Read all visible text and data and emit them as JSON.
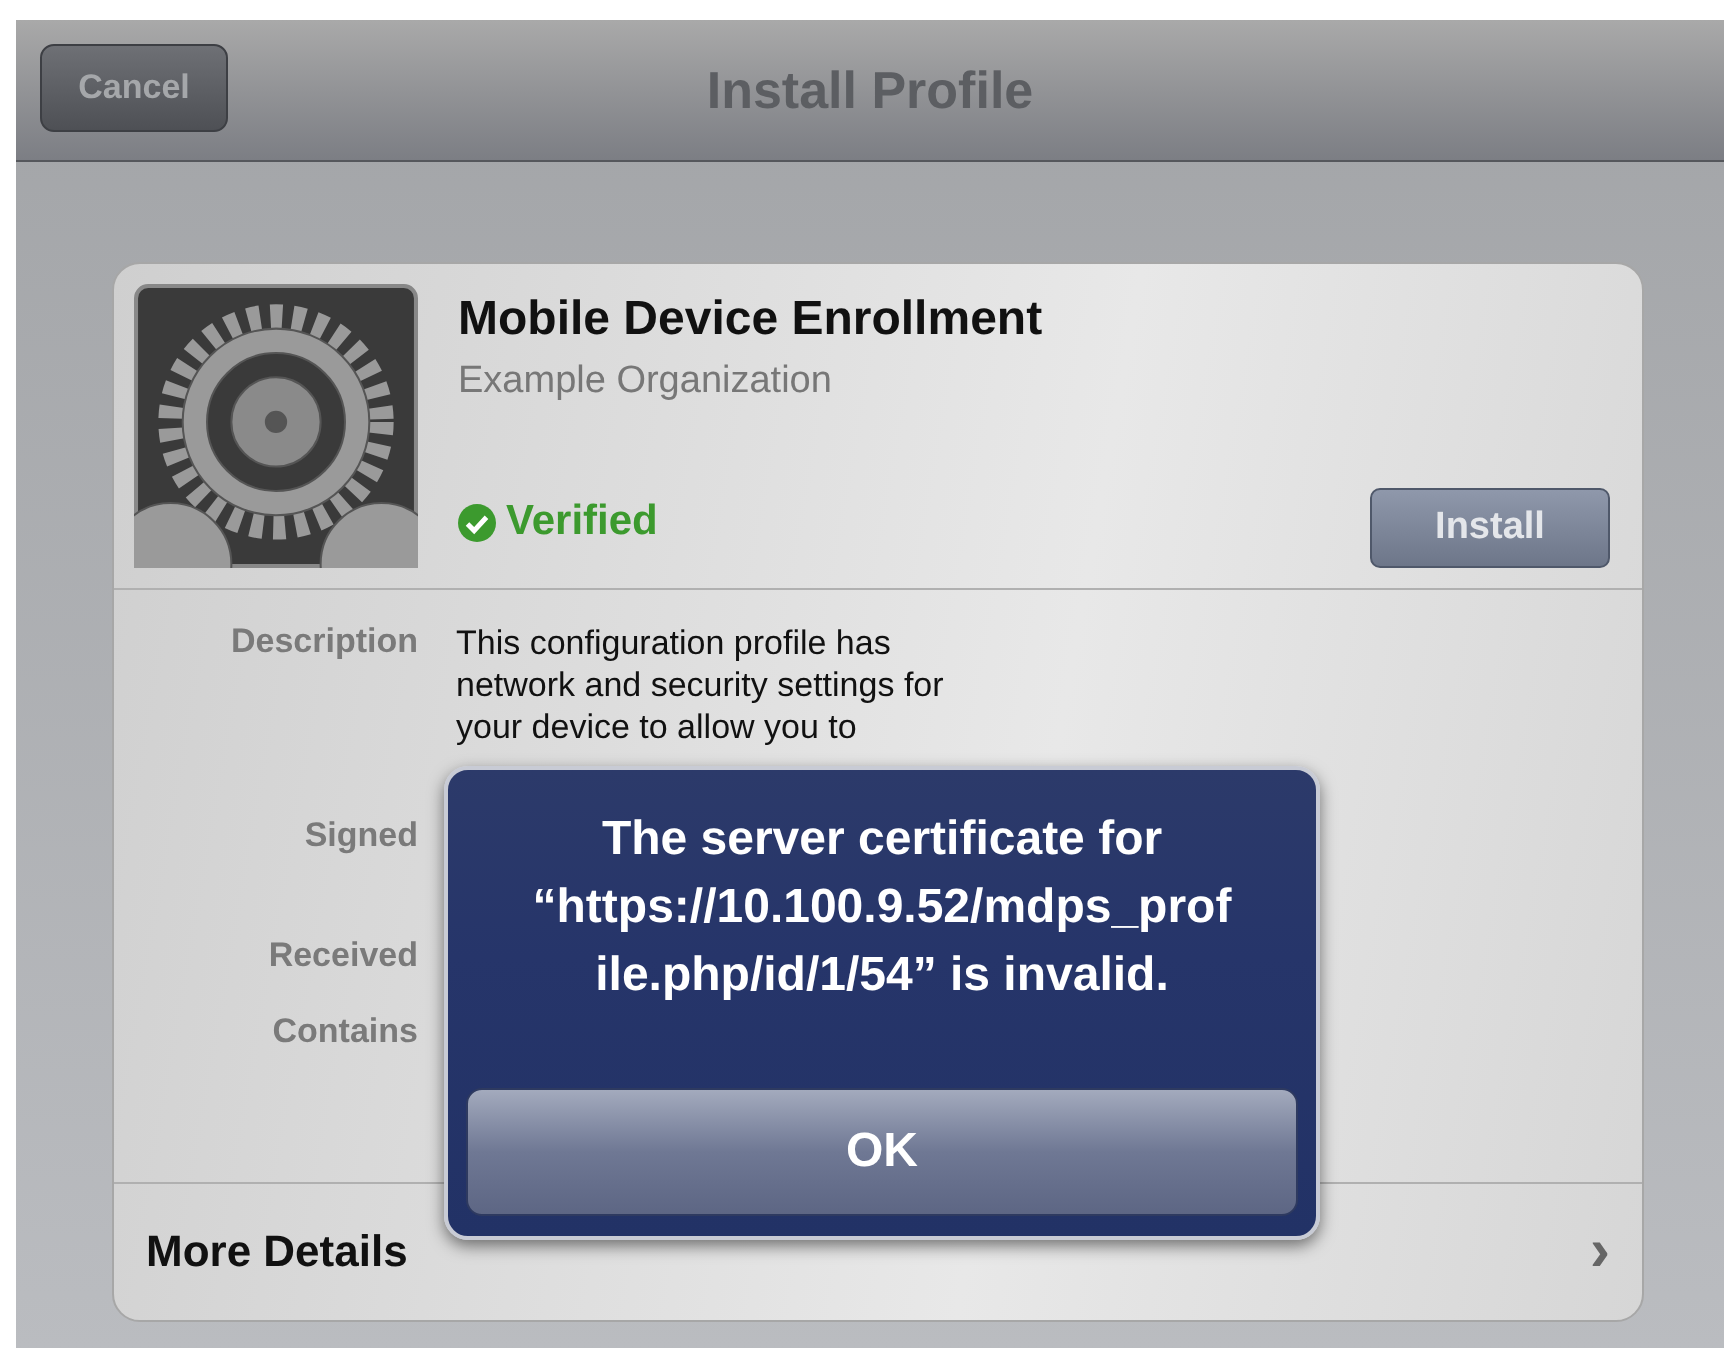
{
  "nav_bar": {
    "cancel_button": "Cancel",
    "title": "Install Profile"
  },
  "profile": {
    "name": "Mobile Device Enrollment",
    "organization": "Example Organization",
    "verified": true,
    "verified_label": "Verified",
    "install_button": "Install"
  },
  "details": [
    {
      "label": "Description",
      "value": "This configuration profile has network and security settings for your device to allow you to"
    },
    {
      "label": "Signed"
    },
    {
      "label": "Received"
    },
    {
      "label": "Contains"
    }
  ],
  "more_details": {
    "label": "More Details",
    "chevron": "›"
  },
  "alert": {
    "message": "The server certificate for “https://10.100.9.52/mdps_profile.php/id/1/54” is invalid.",
    "button": "OK"
  }
}
